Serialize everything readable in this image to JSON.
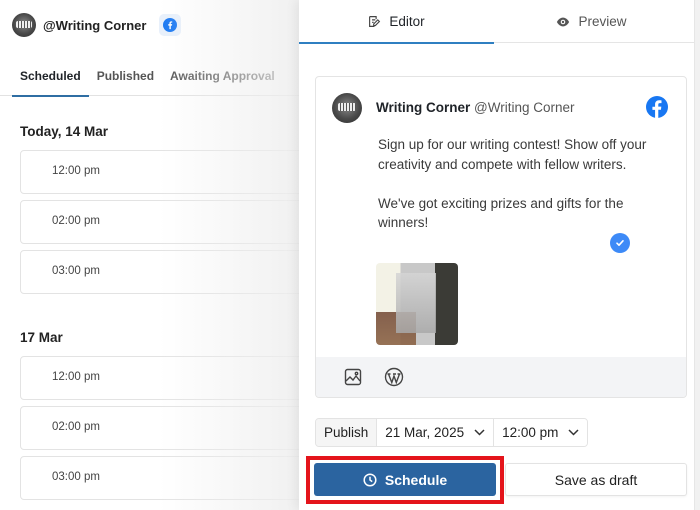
{
  "account": {
    "handle": "@Writing Corner",
    "network_icon": "facebook-icon"
  },
  "left_tabs": [
    {
      "label": "Scheduled",
      "active": true
    },
    {
      "label": "Published",
      "active": false
    },
    {
      "label": "Awaiting Approval",
      "active": false
    }
  ],
  "schedule": [
    {
      "day": "Today, 14 Mar",
      "slots": [
        "12:00 pm",
        "02:00 pm",
        "03:00 pm"
      ]
    },
    {
      "day": "17 Mar",
      "slots": [
        "12:00 pm",
        "02:00 pm",
        "03:00 pm"
      ]
    }
  ],
  "right_tabs": [
    {
      "label": "Editor",
      "icon": "editor-icon",
      "active": true
    },
    {
      "label": "Preview",
      "icon": "eye-icon",
      "active": false
    }
  ],
  "post": {
    "author_name": "Writing Corner",
    "author_handle": "@Writing Corner",
    "network_icon": "facebook-icon",
    "text": "Sign up for our writing contest! Show off your creativity and compete with fellow writers.\n\nWe've got exciting prizes and gifts for the winners!",
    "toolbar_icons": [
      "image-icon",
      "wordpress-icon"
    ]
  },
  "publish": {
    "label": "Publish",
    "date": "21 Mar, 2025",
    "time": "12:00 pm"
  },
  "actions": {
    "schedule_label": "Schedule",
    "draft_label": "Save as draft"
  },
  "colors": {
    "accent": "#2b64a0",
    "tab_underline": "#2f7fc1",
    "facebook": "#1877f2",
    "highlight": "#e4141b"
  }
}
